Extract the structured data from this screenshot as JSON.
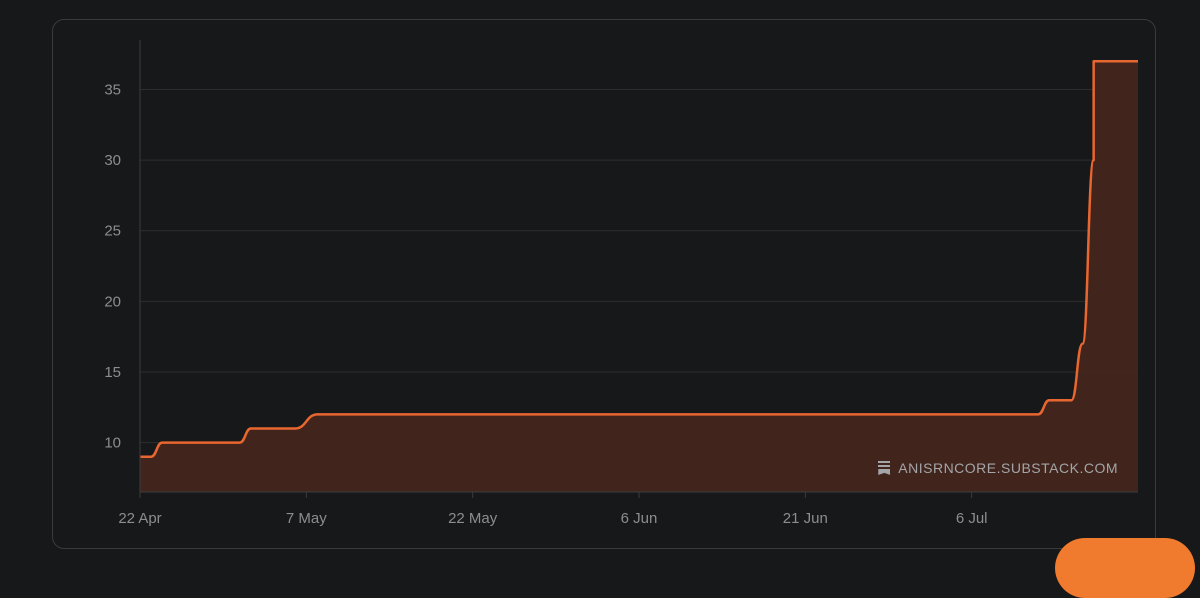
{
  "watermark": {
    "text": "ANISRNCORE.SUBSTACK.COM",
    "icon": "substack-bookmark-icon"
  },
  "colors": {
    "background": "#171819",
    "line": "#e8662f",
    "area": "#43261c",
    "grid": "#2c2d2f",
    "axis_text": "#8b8d90"
  },
  "chart_data": {
    "type": "area",
    "title": "",
    "xlabel": "",
    "ylabel": "",
    "x_ticks": [
      "22 Apr",
      "7 May",
      "22 May",
      "6 Jun",
      "21 Jun",
      "6 Jul"
    ],
    "y_ticks": [
      10,
      15,
      20,
      25,
      30,
      35
    ],
    "ylim": [
      6.5,
      38.5
    ],
    "xlim": [
      "2024-04-22",
      "2024-07-21"
    ],
    "grid": true,
    "series": [
      {
        "values": [
          {
            "x": "2024-04-22",
            "y": 9
          },
          {
            "x": "2024-04-23",
            "y": 9
          },
          {
            "x": "2024-04-24",
            "y": 10
          },
          {
            "x": "2024-05-01",
            "y": 10
          },
          {
            "x": "2024-05-02",
            "y": 11
          },
          {
            "x": "2024-05-06",
            "y": 11
          },
          {
            "x": "2024-05-08",
            "y": 12
          },
          {
            "x": "2024-07-12",
            "y": 12
          },
          {
            "x": "2024-07-13",
            "y": 13
          },
          {
            "x": "2024-07-15",
            "y": 13
          },
          {
            "x": "2024-07-16",
            "y": 17
          },
          {
            "x": "2024-07-17",
            "y": 30
          },
          {
            "x": "2024-07-17",
            "y": 37
          },
          {
            "x": "2024-07-21",
            "y": 37
          }
        ]
      }
    ]
  }
}
